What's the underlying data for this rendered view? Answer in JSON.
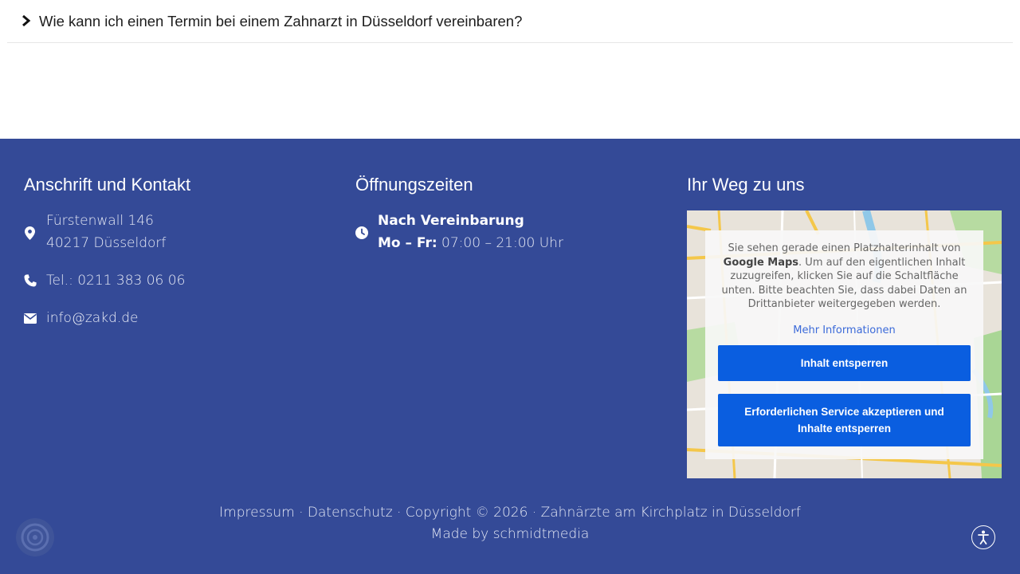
{
  "faq": {
    "question": "Wie kann ich einen Termin bei einem Zahnarzt in Düsseldorf vereinbaren?"
  },
  "footer": {
    "contact": {
      "title": "Anschrift und Kontakt",
      "street": "Fürstenwall 146",
      "city": "40217 Düsseldorf",
      "phone": "Tel.: 0211 383 06 06",
      "email": "info@zakd.de"
    },
    "hours": {
      "title": "Öffnungszeiten",
      "line1": "Nach Vereinbarung",
      "days_label": "Mo – Fr:",
      "days_hours": " 07:00 – 21:00 Uhr"
    },
    "map": {
      "title": "Ihr Weg zu uns",
      "text_before": "Sie sehen gerade einen Platzhalterinhalt von ",
      "brand": "Google Maps",
      "text_after": ". Um auf den eigentlichen Inhalt zuzugreifen, klicken Sie auf die Schaltfläche unten. Bitte beachten Sie, dass dabei Daten an Drittanbieter weitergegeben werden.",
      "more_info": "Mehr Informationen",
      "unlock_button": "Inhalt entsperren",
      "accept_button": "Erforderlichen Service akzeptieren und Inhalte entsperren"
    },
    "bottom": {
      "impressum": "Impressum",
      "sep1": " · ",
      "datenschutz": "Datenschutz",
      "copyright": " · Copyright © 2026 · Zahnärzte am Kirchplatz in Düsseldorf",
      "made_by_prefix": "Made by ",
      "made_by": "schmidtmedia"
    },
    "colors": {
      "background": "#344a97",
      "button": "#0a5ee0",
      "link": "#3b6ad9"
    }
  },
  "icons": {
    "faq": "chevron-right-icon",
    "address": "map-pin-icon",
    "phone": "phone-icon",
    "email": "envelope-icon",
    "hours": "clock-icon",
    "accessibility": "accessibility-icon",
    "cookie": "cookie-settings-icon"
  }
}
